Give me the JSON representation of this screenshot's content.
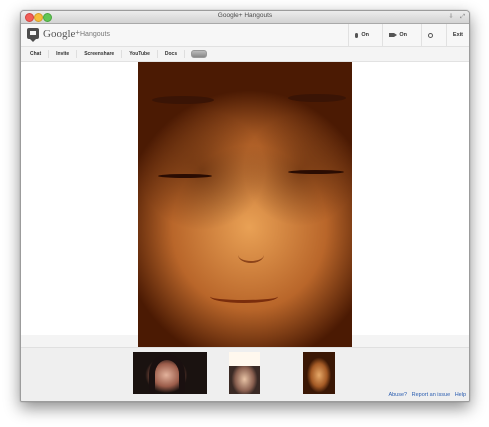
{
  "window": {
    "title": "Google+ Hangouts",
    "titlebar_right": [
      "⇩",
      "⤢"
    ]
  },
  "gbar": {
    "brand": "Google",
    "brand_plus": "+",
    "product": "Hangouts",
    "mic_label": "On",
    "camera_label": "On",
    "exit_label": "Exit"
  },
  "toolbar": {
    "items": [
      "Chat",
      "Invite",
      "Screenshare",
      "YouTube",
      "Docs"
    ]
  },
  "footer": {
    "links": [
      "Abuse?",
      "Report an issue",
      "Help"
    ]
  },
  "colors": {
    "link": "#2a5db0",
    "window_background": "#f4f4f4"
  }
}
